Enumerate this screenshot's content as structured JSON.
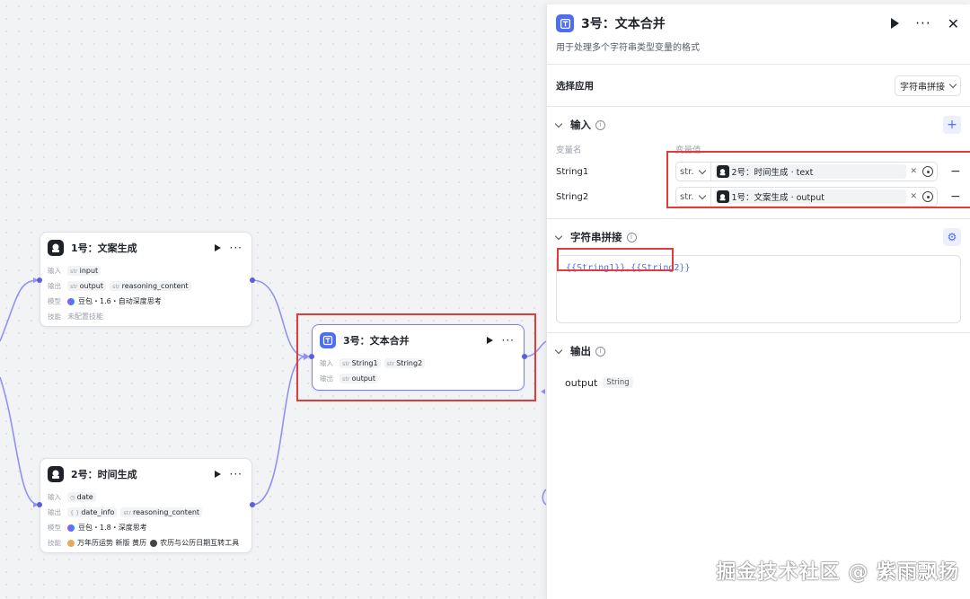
{
  "nodes": {
    "n1": {
      "title": "1号：文案生成",
      "input_label": "输入",
      "input_var": {
        "type": "str",
        "name": "input"
      },
      "output_label": "输出",
      "outputs": [
        {
          "type": "str",
          "name": "output"
        },
        {
          "type": "str",
          "name": "reasoning_content"
        }
      ],
      "model_label": "模型",
      "model": "豆包・1.6・自动深度思考",
      "skill_label": "技能",
      "skill": "未配置技能"
    },
    "n2": {
      "title": "2号：时间生成",
      "input_label": "输入",
      "input_var": {
        "type": "◷",
        "name": "date"
      },
      "output_label": "输出",
      "outputs": [
        {
          "type": "{ }",
          "name": "date_info"
        },
        {
          "type": "str",
          "name": "reasoning_content"
        }
      ],
      "model_label": "模型",
      "model": "豆包・1.8・深度思考",
      "skill_label": "技能",
      "skills": [
        "万年历运势 新版 黄历",
        "农历与公历日期互转工具"
      ]
    },
    "n3": {
      "title": "3号：文本合并",
      "input_label": "输入",
      "inputs": [
        {
          "type": "str",
          "name": "String1"
        },
        {
          "type": "str",
          "name": "String2"
        }
      ],
      "output_label": "输出",
      "output": {
        "type": "str",
        "name": "output"
      }
    }
  },
  "panel": {
    "title": "3号：文本合并",
    "description": "用于处理多个字符串类型变量的格式",
    "select_app_label": "选择应用",
    "select_app_value": "字符串拼接",
    "input_section": "输入",
    "col_name": "变量名",
    "col_value": "变量值",
    "variables": [
      {
        "name": "String1",
        "type": "str.",
        "ref": "2号：时间生成 · text"
      },
      {
        "name": "String2",
        "type": "str.",
        "ref": "1号：文案生成 · output"
      }
    ],
    "concat_section": "字符串拼接",
    "concat_template": "{{String1}},{{String2}}",
    "output_section": "输出",
    "output_name": "output",
    "output_type": "String"
  },
  "watermark": "掘金技术社区 @ 紫雨飘扬",
  "colors": {
    "accent": "#4e6ef2",
    "edge": "#7b7ff0",
    "highlight": "#e23b3b"
  }
}
